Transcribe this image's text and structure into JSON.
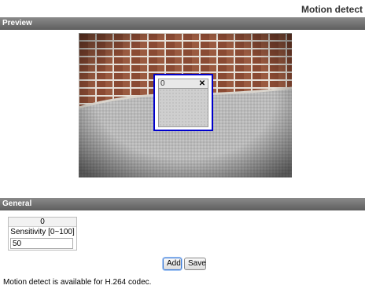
{
  "header": {
    "title": "Motion detect"
  },
  "sections": {
    "preview": "Preview",
    "general": "General"
  },
  "preview": {
    "region": {
      "label": "0",
      "close_glyph": "✕"
    }
  },
  "general": {
    "table_header": "0",
    "sensitivity_label": "Sensitivity [0~100]",
    "sensitivity_value": "50"
  },
  "buttons": {
    "add": "Add",
    "save": "Save"
  },
  "footer": {
    "note": "Motion detect is available for H.264 codec."
  },
  "colors": {
    "section_bar": "#6e6e6e",
    "region_border": "#0000cc",
    "brick": "#8b4a33"
  }
}
